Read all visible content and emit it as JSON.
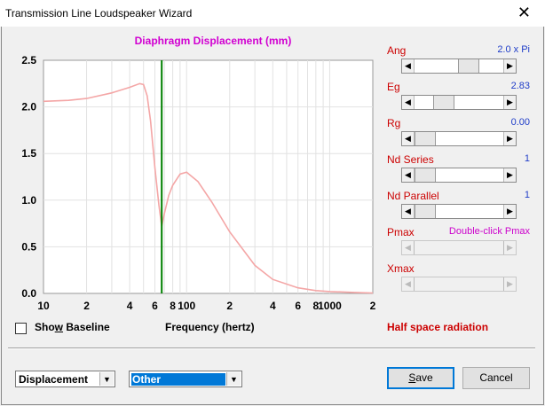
{
  "window": {
    "title": "Transmission Line Loudspeaker Wizard",
    "close_glyph": "✕"
  },
  "chart_data": {
    "type": "line",
    "title": "Diaphragm Displacement (mm)",
    "xlabel": "Frequency (hertz)",
    "ylabel": "",
    "x_scale": "log",
    "xlim": [
      10,
      2000
    ],
    "ylim": [
      0,
      2.5
    ],
    "y_ticks": [
      "2.5",
      "2.0",
      "1.5",
      "1.0",
      "0.5",
      "0.0"
    ],
    "x_tick_labels": [
      {
        "value": 10,
        "label": "10"
      },
      {
        "value": 20,
        "label": "2"
      },
      {
        "value": 40,
        "label": "4"
      },
      {
        "value": 60,
        "label": "6"
      },
      {
        "value": 80,
        "label": "8"
      },
      {
        "value": 100,
        "label": "100"
      },
      {
        "value": 200,
        "label": "2"
      },
      {
        "value": 400,
        "label": "4"
      },
      {
        "value": 600,
        "label": "6"
      },
      {
        "value": 800,
        "label": "8"
      },
      {
        "value": 1000,
        "label": "1000"
      },
      {
        "value": 2000,
        "label": "2"
      }
    ],
    "grid": true,
    "marker_frequency": 67,
    "series": [
      {
        "color": "#f4a6a6",
        "x": [
          10,
          15,
          20,
          30,
          40,
          47,
          50,
          53,
          56,
          60,
          64,
          67,
          70,
          75,
          80,
          90,
          100,
          120,
          150,
          200,
          300,
          400,
          600,
          800,
          1000,
          1500,
          2000
        ],
        "y": [
          2.06,
          2.07,
          2.09,
          2.15,
          2.21,
          2.25,
          2.24,
          2.12,
          1.85,
          1.35,
          0.95,
          0.72,
          0.86,
          1.05,
          1.16,
          1.28,
          1.3,
          1.2,
          0.98,
          0.66,
          0.3,
          0.15,
          0.06,
          0.03,
          0.02,
          0.01,
          0.005
        ]
      }
    ]
  },
  "params": [
    {
      "label": "Ang",
      "value": "2.0 x Pi",
      "color": "#1e3cc8",
      "thumb_pos": 0.63,
      "disabled": false
    },
    {
      "label": "Eg",
      "value": "2.83",
      "color": "#1e3cc8",
      "thumb_pos": 0.27,
      "disabled": false
    },
    {
      "label": "Rg",
      "value": "0.00",
      "color": "#1e3cc8",
      "thumb_pos": 0.0,
      "disabled": false
    },
    {
      "label": "Nd  Series",
      "value": "1",
      "color": "#1e3cc8",
      "thumb_pos": 0.0,
      "disabled": false
    },
    {
      "label": "Nd  Parallel",
      "value": "1",
      "color": "#1e3cc8",
      "thumb_pos": 0.0,
      "disabled": false
    },
    {
      "label": "Pmax",
      "value": "Double-click Pmax",
      "color": "#cc00cc",
      "thumb_pos": null,
      "disabled": true
    },
    {
      "label": "Xmax",
      "value": "",
      "color": "#1e3cc8",
      "thumb_pos": null,
      "disabled": true
    }
  ],
  "baseline": {
    "label": "Show Baseline",
    "checked": false
  },
  "radiation_label": "Half space radiation",
  "combos": {
    "plot_type": "Displacement",
    "other": "Other"
  },
  "buttons": {
    "save": "Save",
    "cancel": "Cancel"
  },
  "icons": {
    "dropdown": "▼",
    "left_arrow": "◀",
    "right_arrow": "▶"
  }
}
